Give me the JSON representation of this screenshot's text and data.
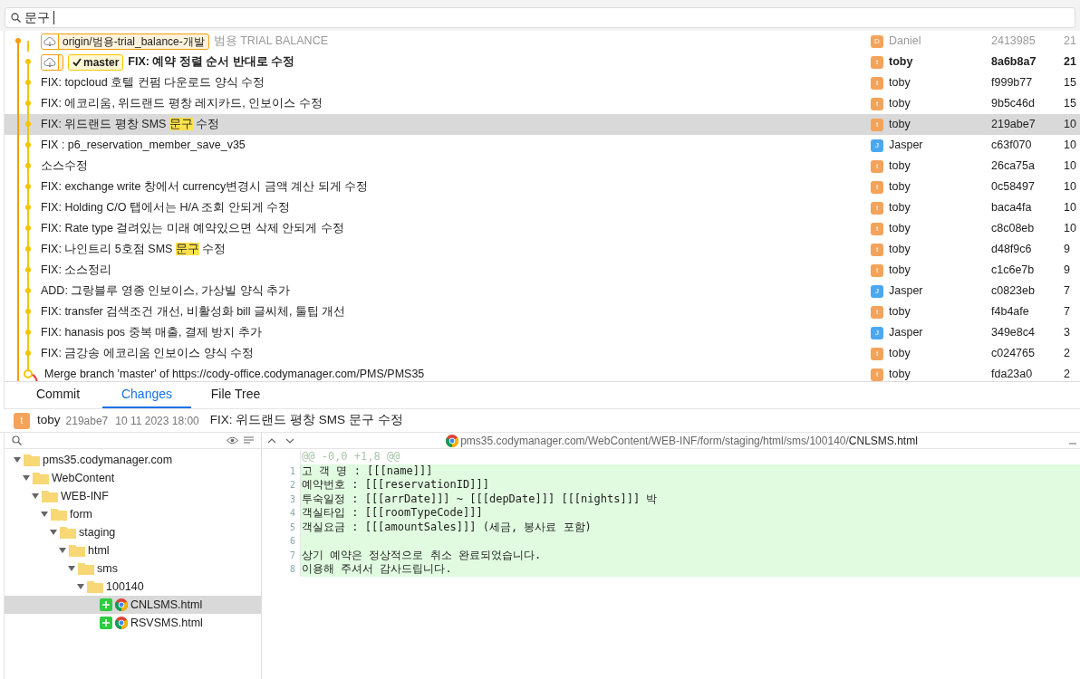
{
  "search": {
    "value": "문구"
  },
  "commits": [
    {
      "refs": [
        {
          "kind": "remote",
          "label": "origin/범용-trial_balance-개발"
        }
      ],
      "message": [
        {
          "text": "범용 TRIAL BALANCE",
          "match": false
        }
      ],
      "faded": true,
      "head": false,
      "selected": false,
      "kind": "commit",
      "color": "#f59e0b",
      "avatar": {
        "letter": "D",
        "color": "#f4a35a"
      },
      "author": "Daniel",
      "hash": "2413985",
      "date": "21"
    },
    {
      "refs": [
        {
          "kind": "remote"
        },
        {
          "kind": "branch",
          "label": "master"
        }
      ],
      "message": [
        {
          "text": "FIX: 예약 정렬 순서 반대로 수정",
          "match": false
        }
      ],
      "faded": false,
      "head": true,
      "selected": false,
      "kind": "commit",
      "color": "#f5c400",
      "avatar": {
        "letter": "t",
        "color": "#f4a35a"
      },
      "author": "toby",
      "hash": "8a6b8a7",
      "date": "21"
    },
    {
      "message": [
        {
          "text": "FIX: topcloud 호텔 컨펌 다운로드 양식 수정",
          "match": false
        }
      ],
      "faded": false,
      "head": false,
      "selected": false,
      "kind": "commit",
      "color": "#f5c400",
      "avatar": {
        "letter": "t",
        "color": "#f4a35a"
      },
      "author": "toby",
      "hash": "f999b77",
      "date": "15"
    },
    {
      "message": [
        {
          "text": "FIX: 에코리움, 위드랜드 평창 레지카드, 인보이스 수정",
          "match": false
        }
      ],
      "faded": false,
      "head": false,
      "selected": false,
      "kind": "commit",
      "color": "#f5c400",
      "avatar": {
        "letter": "t",
        "color": "#f4a35a"
      },
      "author": "toby",
      "hash": "9b5c46d",
      "date": "15"
    },
    {
      "message": [
        {
          "text": "FIX: 위드랜드 평창 SMS ",
          "match": false
        },
        {
          "text": "문구",
          "match": true
        },
        {
          "text": " 수정",
          "match": false
        }
      ],
      "faded": false,
      "head": false,
      "selected": true,
      "kind": "commit",
      "color": "#f5c400",
      "avatar": {
        "letter": "t",
        "color": "#f4a35a"
      },
      "author": "toby",
      "hash": "219abe7",
      "date": "10"
    },
    {
      "message": [
        {
          "text": "FIX : p6_reservation_member_save_v35",
          "match": false
        }
      ],
      "faded": false,
      "head": false,
      "selected": false,
      "kind": "commit",
      "color": "#f5c400",
      "avatar": {
        "letter": "J",
        "color": "#4aa8f0"
      },
      "author": "Jasper",
      "hash": "c63f070",
      "date": "10"
    },
    {
      "message": [
        {
          "text": "소스수정",
          "match": false
        }
      ],
      "faded": false,
      "head": false,
      "selected": false,
      "kind": "commit",
      "color": "#f5c400",
      "avatar": {
        "letter": "t",
        "color": "#f4a35a"
      },
      "author": "toby",
      "hash": "26ca75a",
      "date": "10"
    },
    {
      "message": [
        {
          "text": "FIX: exchange write 창에서 currency변경시 금액 계산 되게 수정",
          "match": false
        }
      ],
      "faded": false,
      "head": false,
      "selected": false,
      "kind": "commit",
      "color": "#f5c400",
      "avatar": {
        "letter": "t",
        "color": "#f4a35a"
      },
      "author": "toby",
      "hash": "0c58497",
      "date": "10"
    },
    {
      "message": [
        {
          "text": "FIX: Holding C/O 탭에서는 H/A 조회 안되게 수정",
          "match": false
        }
      ],
      "faded": false,
      "head": false,
      "selected": false,
      "kind": "commit",
      "color": "#f5c400",
      "avatar": {
        "letter": "t",
        "color": "#f4a35a"
      },
      "author": "toby",
      "hash": "baca4fa",
      "date": "10"
    },
    {
      "message": [
        {
          "text": "FIX: Rate type 걸려있는 미래 예약있으면 삭제 안되게 수정",
          "match": false
        }
      ],
      "faded": false,
      "head": false,
      "selected": false,
      "kind": "commit",
      "color": "#f5c400",
      "avatar": {
        "letter": "t",
        "color": "#f4a35a"
      },
      "author": "toby",
      "hash": "c8c08eb",
      "date": "10"
    },
    {
      "message": [
        {
          "text": "FIX: 나인트리 5호점 SMS ",
          "match": false
        },
        {
          "text": "문구",
          "match": true
        },
        {
          "text": " 수정",
          "match": false
        }
      ],
      "faded": false,
      "head": false,
      "selected": false,
      "kind": "commit",
      "color": "#f5c400",
      "avatar": {
        "letter": "t",
        "color": "#f4a35a"
      },
      "author": "toby",
      "hash": "d48f9c6",
      "date": "9"
    },
    {
      "message": [
        {
          "text": "FIX: 소스정리",
          "match": false
        }
      ],
      "faded": false,
      "head": false,
      "selected": false,
      "kind": "commit",
      "color": "#f5c400",
      "avatar": {
        "letter": "t",
        "color": "#f4a35a"
      },
      "author": "toby",
      "hash": "c1c6e7b",
      "date": "9"
    },
    {
      "message": [
        {
          "text": "ADD: 그랑블루 영종 인보이스, 가상빌 양식 추가",
          "match": false
        }
      ],
      "faded": false,
      "head": false,
      "selected": false,
      "kind": "commit",
      "color": "#f5c400",
      "avatar": {
        "letter": "J",
        "color": "#4aa8f0"
      },
      "author": "Jasper",
      "hash": "c0823eb",
      "date": "7"
    },
    {
      "message": [
        {
          "text": "FIX: transfer 검색조건 개선, 비활성화 bill 글씨체, 툴팁 개선",
          "match": false
        }
      ],
      "faded": false,
      "head": false,
      "selected": false,
      "kind": "commit",
      "color": "#f5c400",
      "avatar": {
        "letter": "t",
        "color": "#f4a35a"
      },
      "author": "toby",
      "hash": "f4b4afe",
      "date": "7"
    },
    {
      "message": [
        {
          "text": "FIX: hanasis pos 중복 매출, 결제 방지 추가",
          "match": false
        }
      ],
      "faded": false,
      "head": false,
      "selected": false,
      "kind": "commit",
      "color": "#f5c400",
      "avatar": {
        "letter": "J",
        "color": "#4aa8f0"
      },
      "author": "Jasper",
      "hash": "349e8c4",
      "date": "3"
    },
    {
      "message": [
        {
          "text": "FIX: 금강송 에코리움 인보이스 양식 수정",
          "match": false
        }
      ],
      "faded": false,
      "head": false,
      "selected": false,
      "kind": "commit",
      "color": "#f5c400",
      "avatar": {
        "letter": "t",
        "color": "#f4a35a"
      },
      "author": "toby",
      "hash": "c024765",
      "date": "2"
    },
    {
      "message": [
        {
          "text": "Merge branch 'master' of https://cody-office.codymanager.com/PMS/PMS35",
          "match": false
        }
      ],
      "faded": false,
      "head": false,
      "selected": false,
      "kind": "merge",
      "color": "#f5c400",
      "avatar": {
        "letter": "t",
        "color": "#f4a35a"
      },
      "author": "toby",
      "hash": "fda23a0",
      "date": "2"
    }
  ],
  "tabs": [
    {
      "label": "Commit",
      "selected": false
    },
    {
      "label": "Changes",
      "selected": true
    },
    {
      "label": "File Tree",
      "selected": false
    }
  ],
  "commit_info": {
    "avatar": {
      "letter": "t",
      "color": "#f4a35a"
    },
    "author": "toby",
    "hash": "219abe7",
    "date": "10 11 2023 18:00",
    "message": "FIX: 위드랜드 평창 SMS 문구 수정"
  },
  "tree": [
    {
      "name": "pms35.codymanager.com",
      "kind": "folder",
      "expanded": true,
      "selected": false,
      "children": [
        {
          "name": "WebContent",
          "kind": "folder",
          "expanded": true,
          "selected": false,
          "children": [
            {
              "name": "WEB-INF",
              "kind": "folder",
              "expanded": true,
              "selected": false,
              "children": [
                {
                  "name": "form",
                  "kind": "folder",
                  "expanded": true,
                  "selected": false,
                  "children": [
                    {
                      "name": "staging",
                      "kind": "folder",
                      "expanded": true,
                      "selected": false,
                      "children": [
                        {
                          "name": "html",
                          "kind": "folder",
                          "expanded": true,
                          "selected": false,
                          "children": [
                            {
                              "name": "sms",
                              "kind": "folder",
                              "expanded": true,
                              "selected": false,
                              "children": [
                                {
                                  "name": "100140",
                                  "kind": "folder",
                                  "expanded": true,
                                  "selected": false,
                                  "children": [
                                    {
                                      "name": "CNLSMS.html",
                                      "kind": "added-file",
                                      "selected": true
                                    },
                                    {
                                      "name": "RSVSMS.html",
                                      "kind": "added-file",
                                      "selected": false
                                    }
                                  ]
                                }
                              ]
                            }
                          ]
                        }
                      ]
                    }
                  ]
                }
              ]
            }
          ]
        }
      ]
    }
  ],
  "diff": {
    "path_dir": "pms35.codymanager.com/WebContent/WEB-INF/form/staging/html/sms/100140/",
    "path_file": "CNLSMS.html",
    "hunk": "@@ -0,0 +1,8 @@",
    "lines": [
      {
        "number": "1",
        "text": "고 객 명 : [[[name]]]"
      },
      {
        "number": "2",
        "text": "예약번호 : [[[reservationID]]]"
      },
      {
        "number": "3",
        "text": "투숙일정 : [[[arrDate]]] ~ [[[depDate]]] [[[nights]]] 박"
      },
      {
        "number": "4",
        "text": "객실타입 : [[[roomTypeCode]]]"
      },
      {
        "number": "5",
        "text": "객실요금 : [[[amountSales]]] (세금, 봉사료 포함)"
      },
      {
        "number": "6"
      },
      {
        "number": "7",
        "text": "상기 예약은 정상적으로 취소 완료되었습니다."
      },
      {
        "number": "8",
        "text": "이용해 주셔서 감사드립니다."
      }
    ]
  }
}
